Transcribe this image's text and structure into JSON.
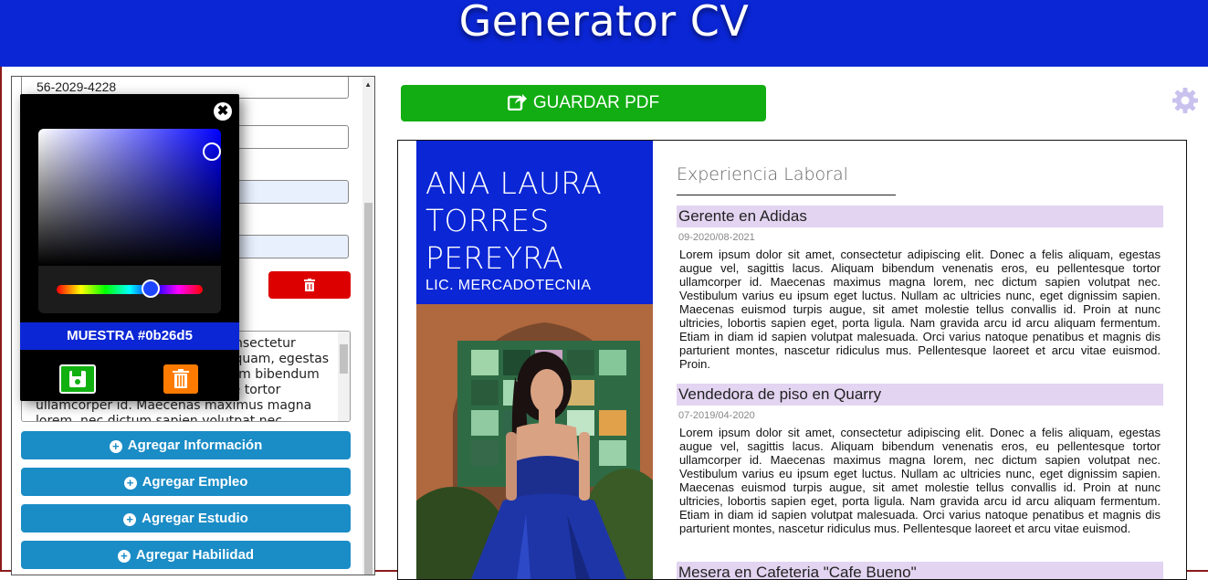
{
  "header": {
    "title": "Generator CV"
  },
  "form": {
    "phone_value": "56-2029-4228",
    "textarea_text": "Lorem ipsum dolor sit amet, consectetur adipiscing elit. Donec a felis aliquam, egestas augue vel, sagittis lacus. Aliquam bibendum venenatis eros, eu pellentesque tortor ullamcorper id. Maecenas maximus magna lorem, nec dictum sapien volutpat nec.",
    "buttons": {
      "add_info": "Agregar Información",
      "add_job": "Agregar Empleo",
      "add_study": "Agregar Estudio",
      "add_skill": "Agregar Habilidad"
    }
  },
  "color_picker": {
    "sample_label": "MUESTRA #0b26d5",
    "selected_color": "#0b26d5"
  },
  "toolbar": {
    "save_pdf_label": "GUARDAR PDF"
  },
  "cv": {
    "name": "ANA LAURA TORRES PEREYRA",
    "profession": "LIC. MERCADOTECNIA",
    "section_title": "Experiencia Laboral",
    "jobs": [
      {
        "title": "Gerente en Adidas",
        "dates": "09-2020/08-2021",
        "description": "Lorem ipsum dolor sit amet, consectetur adipiscing elit. Donec a felis aliquam, egestas augue vel, sagittis lacus. Aliquam bibendum venenatis eros, eu pellentesque tortor ullamcorper id. Maecenas maximus magna lorem, nec dictum sapien volutpat nec. Vestibulum varius eu ipsum eget luctus. Nullam ac ultricies nunc, eget dignissim sapien. Maecenas euismod turpis augue, sit amet molestie tellus convallis id. Proin at nunc ultricies, lobortis sapien eget, porta ligula. Nam gravida arcu id arcu aliquam fermentum. Etiam in diam id sapien volutpat malesuada. Orci varius natoque penatibus et magnis dis parturient montes, nascetur ridiculus mus. Pellentesque laoreet et arcu vitae euismod. Proin."
      },
      {
        "title": "Vendedora de piso en Quarry",
        "dates": "07-2019/04-2020",
        "description": "Lorem ipsum dolor sit amet, consectetur adipiscing elit. Donec a felis aliquam, egestas augue vel, sagittis lacus. Aliquam bibendum venenatis eros, eu pellentesque tortor ullamcorper id. Maecenas maximus magna lorem, nec dictum sapien volutpat nec. Vestibulum varius eu ipsum eget luctus. Nullam ac ultricies nunc, eget dignissim sapien. Maecenas euismod turpis augue, sit amet molestie tellus convallis id. Proin at nunc ultricies, lobortis sapien eget, porta ligula. Nam gravida arcu id arcu aliquam fermentum. Etiam in diam id sapien volutpat malesuada. Orci varius natoque penatibus et magnis dis parturient montes, nascetur ridiculus mus. Pellentesque laoreet et arcu vitae euismod."
      },
      {
        "title": "Mesera en Cafeteria \"Cafe Bueno\""
      }
    ]
  }
}
